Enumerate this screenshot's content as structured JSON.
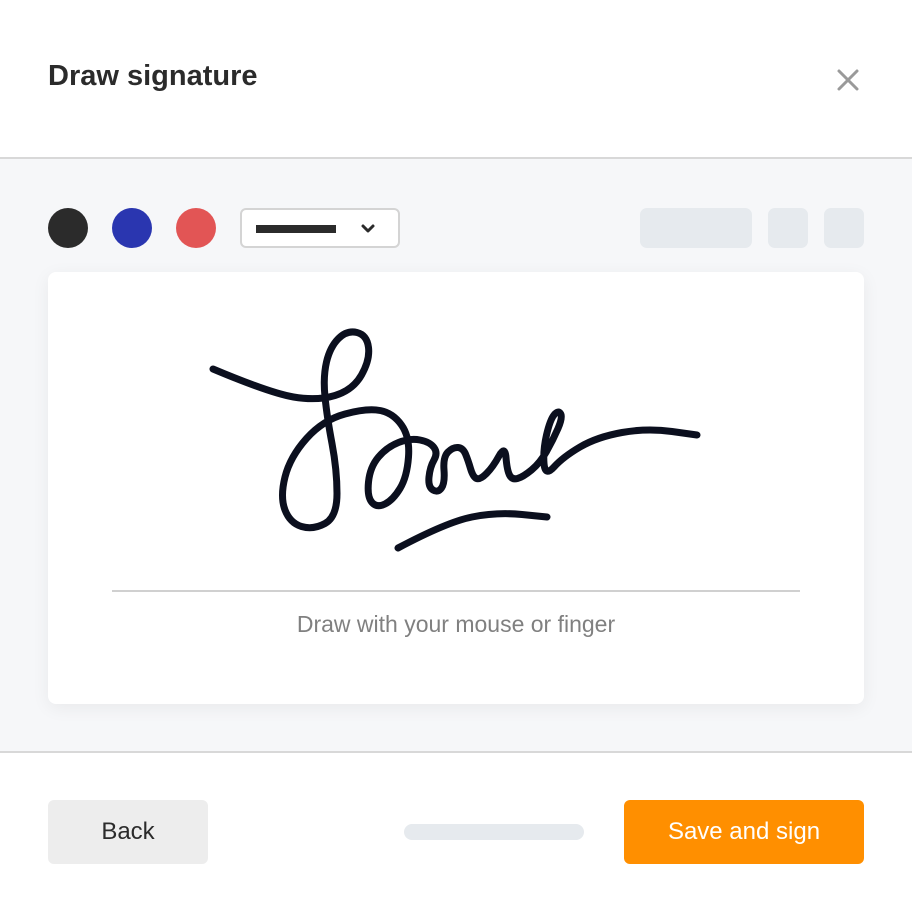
{
  "dialog": {
    "title": "Draw signature",
    "close_icon": "close-icon"
  },
  "toolbar": {
    "colors": [
      "#2b2b2b",
      "#2a36b0",
      "#e25555"
    ],
    "thickness_select": {
      "icon": "chevron-down-icon"
    }
  },
  "pad": {
    "hint": "Draw with your mouse or finger",
    "ink_color": "#0b0f1e"
  },
  "footer": {
    "back_label": "Back",
    "save_label": "Save and sign",
    "accent": "#ff8f00"
  }
}
